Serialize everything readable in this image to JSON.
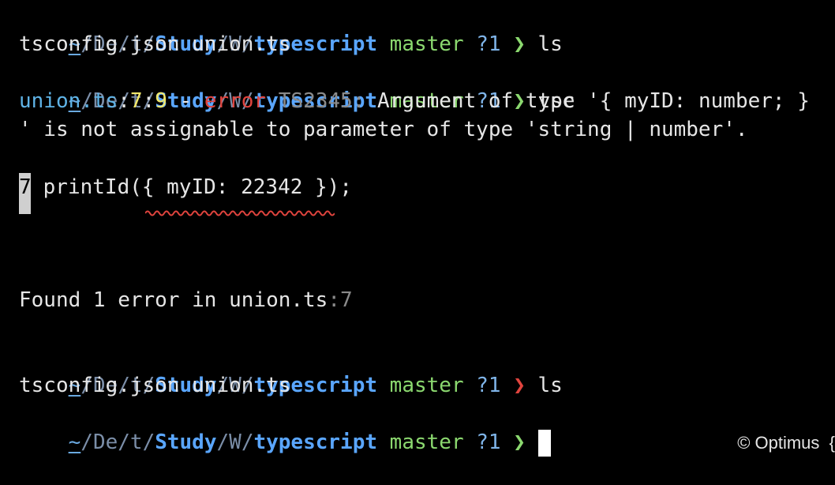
{
  "prompts": [
    {
      "tilde": "~",
      "seg1": "De",
      "seg2": "t",
      "seg3": "Study",
      "seg4": "W",
      "seg5": "typescript",
      "branch": "master",
      "status": "?1",
      "arrow": "❯",
      "command": "ls"
    },
    {
      "tilde": "~",
      "seg1": "De",
      "seg2": "t",
      "seg3": "Study",
      "seg4": "W",
      "seg5": "typescript",
      "branch": "master",
      "status": "?1",
      "arrow": "❯",
      "command": "tsc"
    },
    {
      "tilde": "~",
      "seg1": "De",
      "seg2": "t",
      "seg3": "Study",
      "seg4": "W",
      "seg5": "typescript",
      "branch": "master",
      "status": "?1",
      "arrow": "❯",
      "command": "ls"
    },
    {
      "tilde": "~",
      "seg1": "De",
      "seg2": "t",
      "seg3": "Study",
      "seg4": "W",
      "seg5": "typescript",
      "branch": "master",
      "status": "?1",
      "arrow": "❯",
      "command": ""
    }
  ],
  "ls_output_1": "tsconfig.json union.ts",
  "ls_output_2": "tsconfig.json union.ts",
  "error": {
    "file": "union.ts",
    "colon1": ":",
    "line": "7",
    "colon2": ":",
    "col": "9",
    "dash": " - ",
    "word": "error",
    "code": "TS2345:",
    "message_part1": " Argument of type '{ myID: number; }",
    "message_part2": "' is not assignable to parameter of type 'string | number'."
  },
  "code_snippet": {
    "line_number": "7",
    "code": " printId({ myID: 22342 });"
  },
  "summary": {
    "text": "Found 1 error in union.ts",
    "suffix": ":7"
  },
  "footer_hint": "© Optimus  {"
}
